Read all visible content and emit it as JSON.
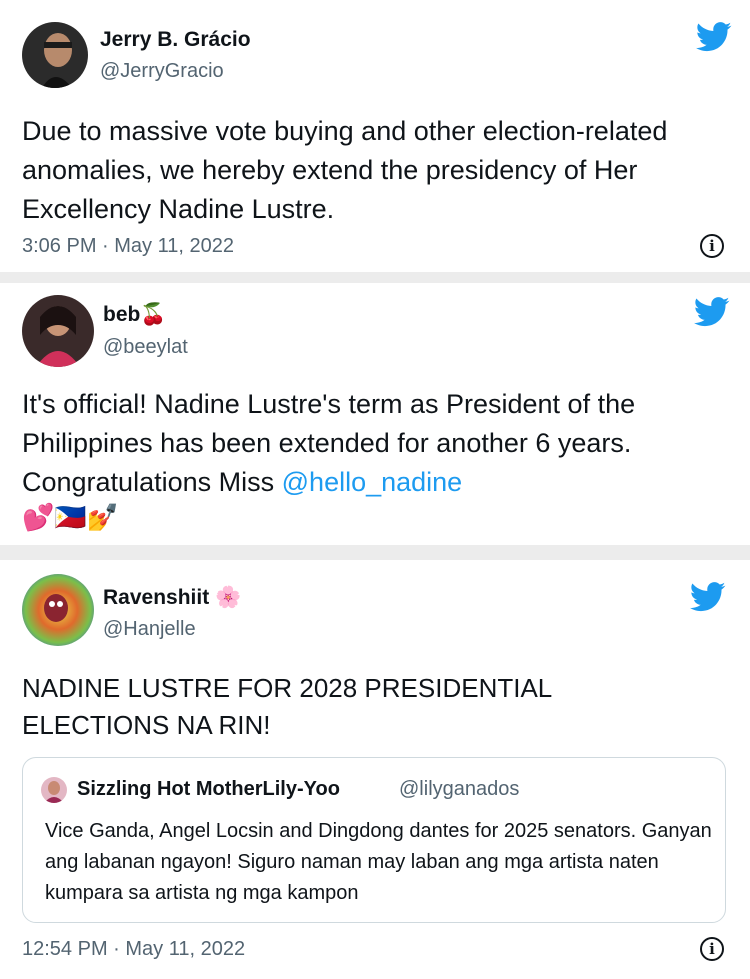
{
  "tweets": [
    {
      "name": "Jerry B. Grácio",
      "handle": "@JerryGracio",
      "text": "Due to massive vote buying and other election-related anomalies, we hereby extend the presidency of Her Excellency Nadine Lustre.",
      "time": "3:06 PM · May 11, 2022"
    },
    {
      "name": "beb",
      "name_emoji": "🍒",
      "handle": "@beeylat",
      "text": "It's official! Nadine Lustre's term as President of the Philippines has been extended for another 6 years. Congratulations Miss",
      "mention": "@hello_nadine",
      "emoji_line": "💕🇵🇭💅"
    },
    {
      "name": "Ravenshiit",
      "name_emoji": "🌸",
      "handle": "@Hanjelle",
      "text": "NADINE LUSTRE FOR 2028 PRESIDENTIAL ELECTIONS NA RIN!",
      "quote": {
        "name": "Sizzling Hot MotherLily-Yoo",
        "handle": "@lilyganados",
        "text": "Vice Ganda, Angel Locsin and Dingdong dantes for 2025 senators. Ganyan ang labanan ngayon! Siguro naman may laban ang mga artista naten kumpara sa artista ng mga kampon"
      },
      "time": "12:54 PM · May 11, 2022"
    }
  ],
  "icons": {
    "bird": "twitter-bird-icon",
    "info": "info-icon"
  },
  "colors": {
    "twitter_blue": "#1d9bf0",
    "text": "#0f1419",
    "muted": "#536471"
  }
}
